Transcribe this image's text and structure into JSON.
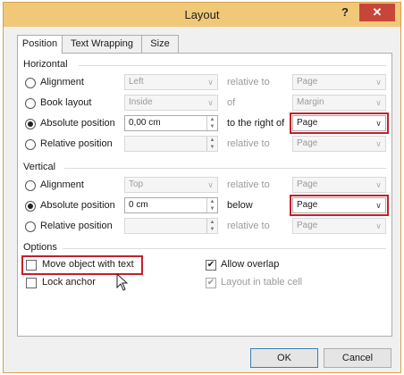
{
  "window": {
    "title": "Layout",
    "help_label": "?",
    "close_label": "✕"
  },
  "tabs": [
    {
      "label": "Position",
      "active": true
    },
    {
      "label": "Text Wrapping",
      "active": false
    },
    {
      "label": "Size",
      "active": false
    }
  ],
  "horizontal": {
    "heading": "Horizontal",
    "rows": [
      {
        "label": "Alignment",
        "selected": false,
        "value": "Left",
        "relation": "relative to",
        "target": "Page"
      },
      {
        "label": "Book layout",
        "selected": false,
        "value": "Inside",
        "relation": "of",
        "target": "Margin"
      },
      {
        "label": "Absolute position",
        "selected": true,
        "value": "0,00 cm",
        "relation": "to the right of",
        "target": "Page"
      },
      {
        "label": "Relative position",
        "selected": false,
        "value": "",
        "relation": "relative to",
        "target": "Page"
      }
    ]
  },
  "vertical": {
    "heading": "Vertical",
    "rows": [
      {
        "label": "Alignment",
        "selected": false,
        "value": "Top",
        "relation": "relative to",
        "target": "Page"
      },
      {
        "label": "Absolute position",
        "selected": true,
        "value": "0 cm",
        "relation": "below",
        "target": "Page"
      },
      {
        "label": "Relative position",
        "selected": false,
        "value": "",
        "relation": "relative to",
        "target": "Page"
      }
    ]
  },
  "options": {
    "heading": "Options",
    "move_object": {
      "label": "Move object with text",
      "checked": false
    },
    "lock_anchor": {
      "label": "Lock anchor",
      "checked": false
    },
    "allow_overlap": {
      "label": "Allow overlap",
      "checked": true
    },
    "layout_in_table": {
      "label": "Layout in table cell",
      "checked": true
    }
  },
  "buttons": {
    "ok": "OK",
    "cancel": "Cancel"
  },
  "colors": {
    "titlebar": "#f0c878",
    "close": "#c7463a",
    "highlight": "#c41f2b"
  }
}
